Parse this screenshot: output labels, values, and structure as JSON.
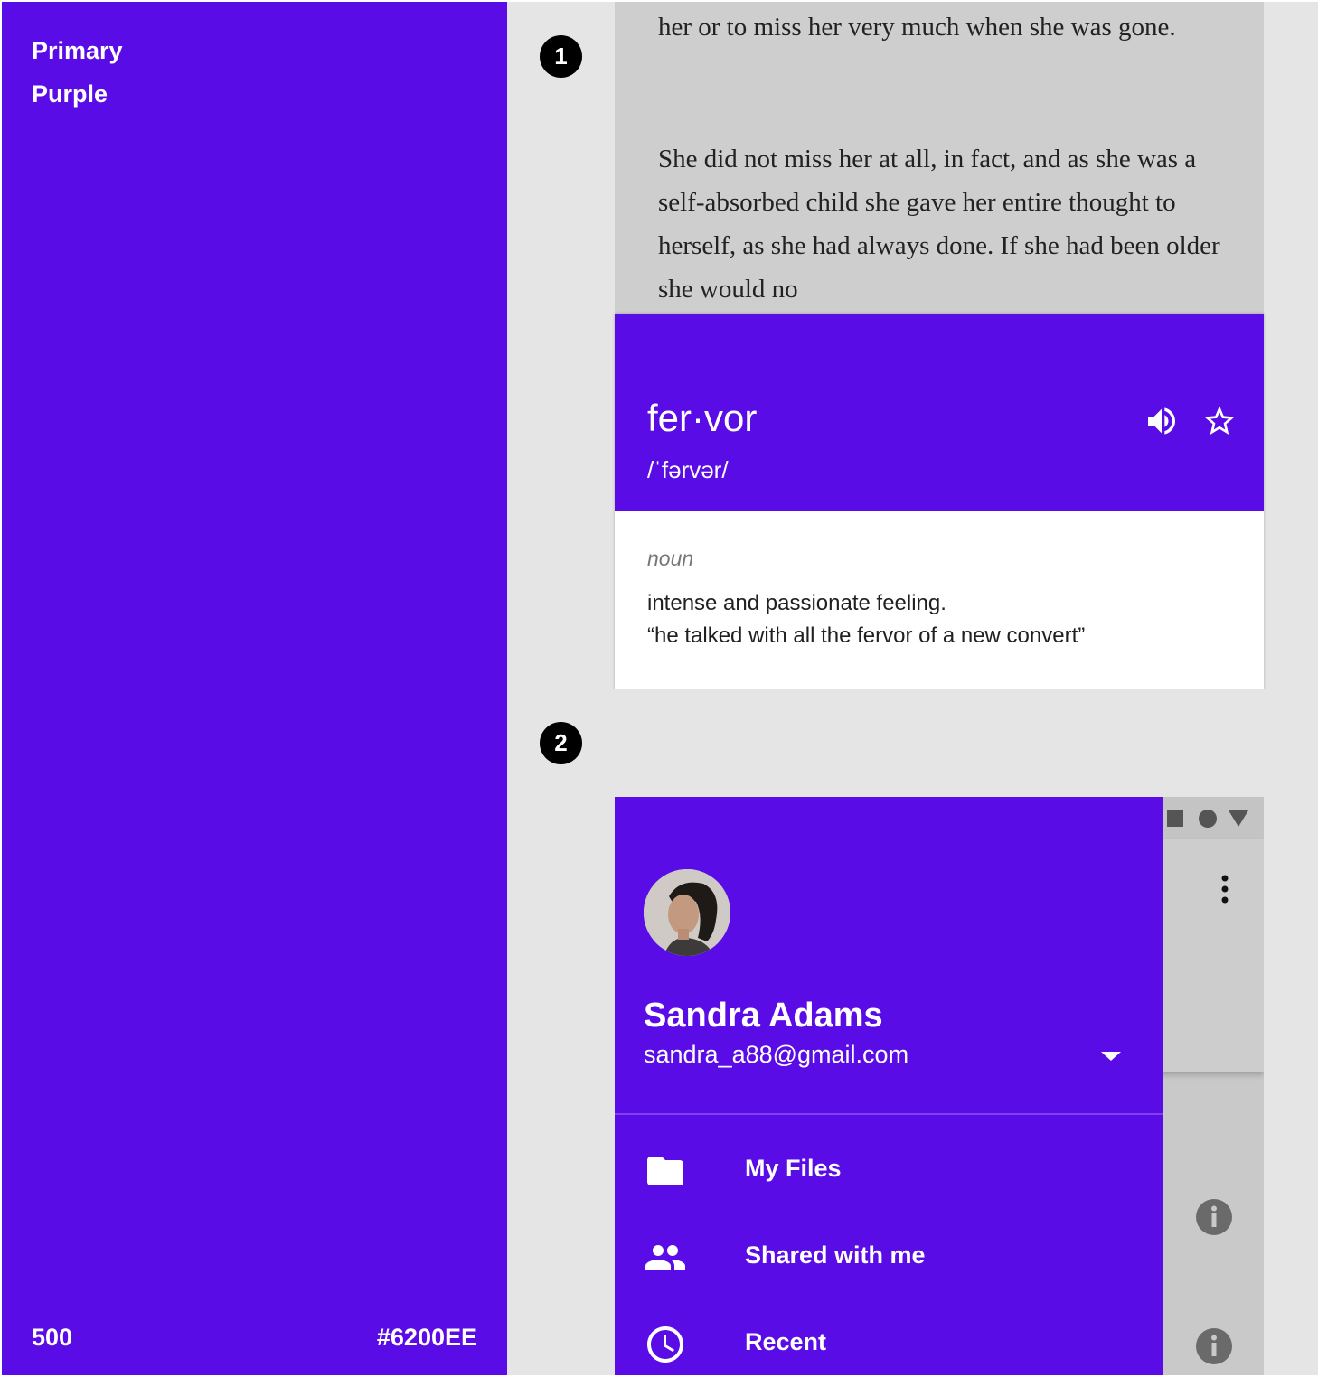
{
  "swatch": {
    "title_line1": "Primary",
    "title_line2": "Purple",
    "level": "500",
    "hex": "#6200EE",
    "color": "#6200EE"
  },
  "examples": [
    {
      "badge": "1",
      "reader": {
        "paragraph1": "her or to miss her very much when she was gone.",
        "paragraph2": "She did not miss her at all, in fact, and as she was a self-absorbed child she gave her entire thought to herself, as she had always done. If she had been older she would no"
      },
      "dictionary": {
        "word": "fer·vor",
        "phonetic": "/ˈfərvər/",
        "speaker_icon": "volume-up-icon",
        "favorite_icon": "star-outline-icon",
        "part_of_speech": "noun",
        "definition": "intense and passionate feeling.",
        "example": "“he talked with all the fervor of a new convert”"
      }
    },
    {
      "badge": "2",
      "drawer": {
        "user_name": "Sandra Adams",
        "user_email": "sandra_a88@gmail.com",
        "items": [
          {
            "label": "My Files",
            "icon": "folder-icon"
          },
          {
            "label": "Shared with me",
            "icon": "people-icon"
          },
          {
            "label": "Recent",
            "icon": "clock-icon"
          }
        ]
      }
    }
  ]
}
